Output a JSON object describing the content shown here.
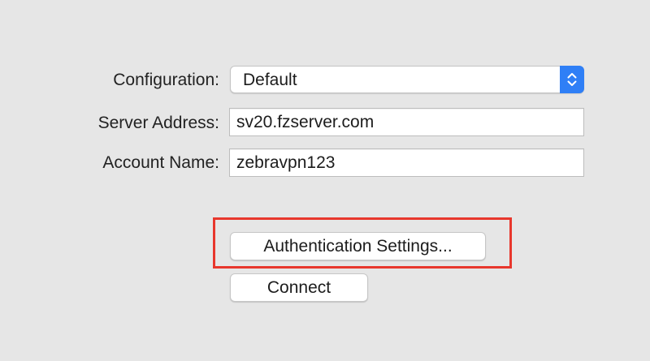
{
  "form": {
    "configuration": {
      "label": "Configuration:",
      "selected": "Default",
      "icon": "chevron-up-down-icon"
    },
    "server_address": {
      "label": "Server Address:",
      "value": "sv20.fzserver.com"
    },
    "account_name": {
      "label": "Account Name:",
      "value": "zebravpn123"
    }
  },
  "buttons": {
    "authentication_settings": "Authentication Settings...",
    "connect": "Connect"
  },
  "colors": {
    "background": "#e6e6e6",
    "accent": "#2f7ff6",
    "highlight": "#e8372d"
  }
}
